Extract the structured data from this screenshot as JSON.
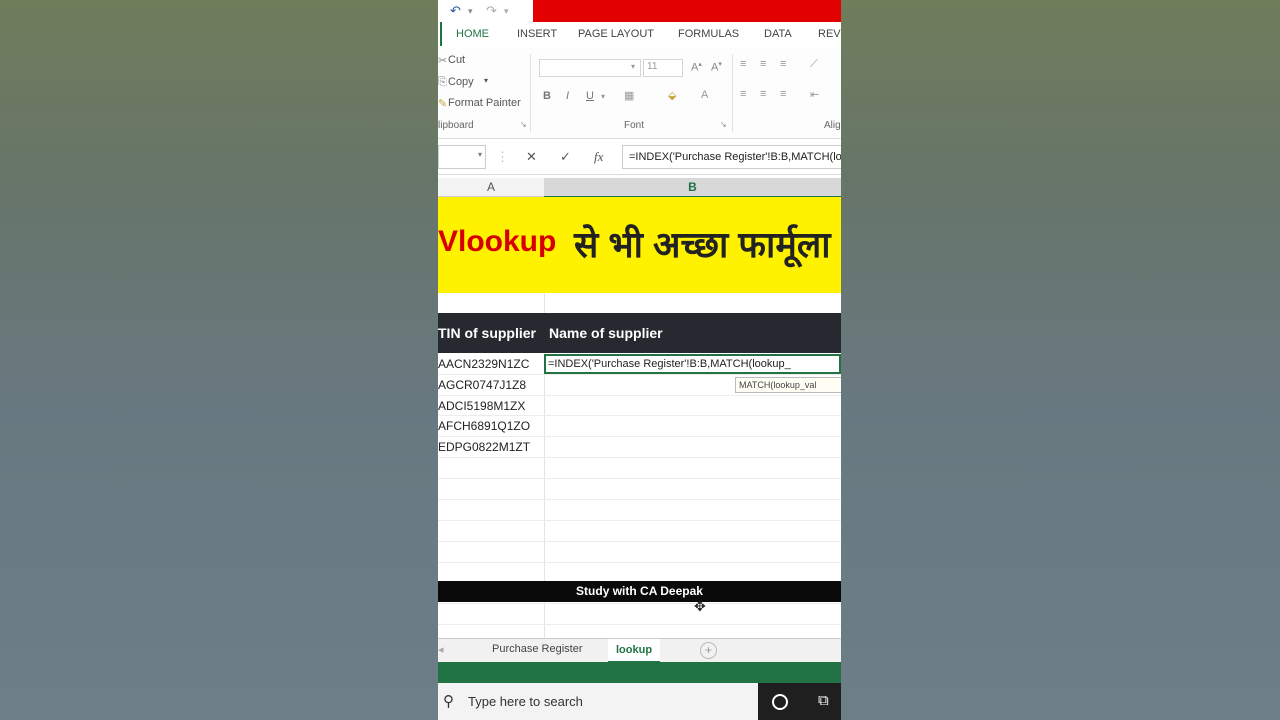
{
  "ribbon_tabs": [
    "HOME",
    "INSERT",
    "PAGE LAYOUT",
    "FORMULAS",
    "DATA",
    "REVI"
  ],
  "clipboard": {
    "cut": "Cut",
    "copy": "Copy",
    "format_painter": "Format Painter",
    "group_label": "lipboard"
  },
  "font": {
    "size": "11",
    "group_label": "Font",
    "bold": "B",
    "italic": "I",
    "underline": "U",
    "align_label": "Alig"
  },
  "formula_bar": {
    "fx": "fx",
    "formula": "=INDEX('Purchase Register'!B:B,MATCH(lookup_"
  },
  "columns": {
    "a": "A",
    "b": "B"
  },
  "banner": {
    "english": "Vlookup",
    "hindi": "से भी अच्छा फार्मूला"
  },
  "table": {
    "header_tin": "TIN of supplier",
    "header_name": "Name of supplier",
    "tins": [
      "AACN2329N1ZC",
      "AGCR0747J1Z8",
      "ADCI5198M1ZX",
      "AFCH6891Q1ZO",
      "EDPG0822M1ZT"
    ],
    "edit_formula": "=INDEX('Purchase Register'!B:B,MATCH(lookup_",
    "tooltip": "MATCH(lookup_val"
  },
  "watermark": "Study with CA Deepak",
  "sheet_tabs": {
    "purchase": "Purchase Register",
    "lookup": "lookup",
    "add": "+"
  },
  "taskbar": {
    "search_placeholder": "Type here to search"
  }
}
